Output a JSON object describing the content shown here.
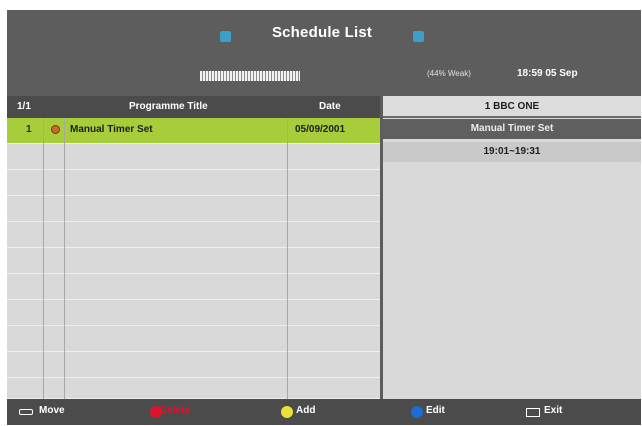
{
  "header": {
    "title": "Schedule List",
    "signal_text": "(44% Weak)",
    "clock": "18:59 05 Sep",
    "accent_color": "#3aa0c8"
  },
  "list": {
    "page": "1/1",
    "columns": {
      "title": "Programme Title",
      "date": "Date"
    },
    "rows": [
      {
        "num": "1",
        "title": "Manual Timer Set",
        "date": "05/09/2001",
        "icon": "timer-record-icon",
        "selected": true
      }
    ],
    "selected_color": "#a7cd3a"
  },
  "detail": {
    "channel": "1 BBC ONE",
    "event": "Manual Timer Set",
    "time": "19:01~19:31"
  },
  "footer": {
    "move_label": "Move",
    "red_label": "Delete",
    "yellow_label": "Add",
    "blue_label": "Edit",
    "exit_label": "Exit"
  }
}
